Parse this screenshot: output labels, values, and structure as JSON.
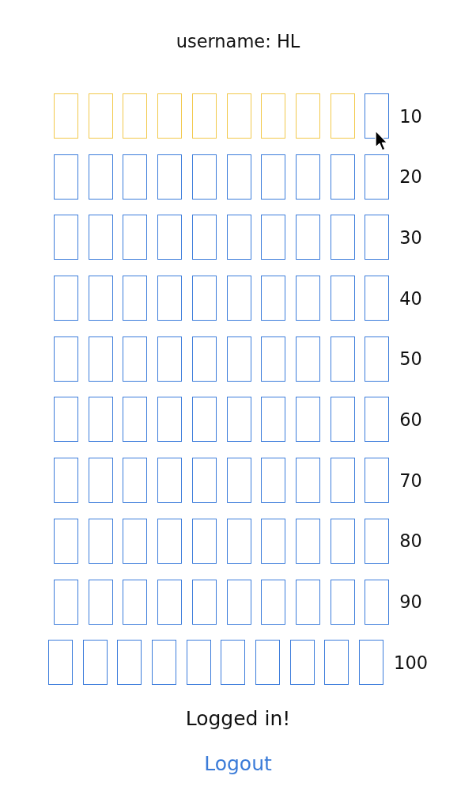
{
  "header": {
    "username_text": "username: HL"
  },
  "grid": {
    "rows": [
      {
        "label": "10",
        "cells": [
          {
            "selected": true,
            "hovered": false
          },
          {
            "selected": true,
            "hovered": false
          },
          {
            "selected": true,
            "hovered": false
          },
          {
            "selected": true,
            "hovered": false
          },
          {
            "selected": true,
            "hovered": false
          },
          {
            "selected": true,
            "hovered": false
          },
          {
            "selected": true,
            "hovered": false
          },
          {
            "selected": true,
            "hovered": false
          },
          {
            "selected": true,
            "hovered": false
          },
          {
            "selected": false,
            "hovered": true
          }
        ]
      },
      {
        "label": "20",
        "cells": [
          {
            "selected": false,
            "hovered": false
          },
          {
            "selected": false,
            "hovered": false
          },
          {
            "selected": false,
            "hovered": false
          },
          {
            "selected": false,
            "hovered": false
          },
          {
            "selected": false,
            "hovered": false
          },
          {
            "selected": false,
            "hovered": false
          },
          {
            "selected": false,
            "hovered": false
          },
          {
            "selected": false,
            "hovered": false
          },
          {
            "selected": false,
            "hovered": false
          },
          {
            "selected": false,
            "hovered": false
          }
        ]
      },
      {
        "label": "30",
        "cells": [
          {
            "selected": false,
            "hovered": false
          },
          {
            "selected": false,
            "hovered": false
          },
          {
            "selected": false,
            "hovered": false
          },
          {
            "selected": false,
            "hovered": false
          },
          {
            "selected": false,
            "hovered": false
          },
          {
            "selected": false,
            "hovered": false
          },
          {
            "selected": false,
            "hovered": false
          },
          {
            "selected": false,
            "hovered": false
          },
          {
            "selected": false,
            "hovered": false
          },
          {
            "selected": false,
            "hovered": false
          }
        ]
      },
      {
        "label": "40",
        "cells": [
          {
            "selected": false,
            "hovered": false
          },
          {
            "selected": false,
            "hovered": false
          },
          {
            "selected": false,
            "hovered": false
          },
          {
            "selected": false,
            "hovered": false
          },
          {
            "selected": false,
            "hovered": false
          },
          {
            "selected": false,
            "hovered": false
          },
          {
            "selected": false,
            "hovered": false
          },
          {
            "selected": false,
            "hovered": false
          },
          {
            "selected": false,
            "hovered": false
          },
          {
            "selected": false,
            "hovered": false
          }
        ]
      },
      {
        "label": "50",
        "cells": [
          {
            "selected": false,
            "hovered": false
          },
          {
            "selected": false,
            "hovered": false
          },
          {
            "selected": false,
            "hovered": false
          },
          {
            "selected": false,
            "hovered": false
          },
          {
            "selected": false,
            "hovered": false
          },
          {
            "selected": false,
            "hovered": false
          },
          {
            "selected": false,
            "hovered": false
          },
          {
            "selected": false,
            "hovered": false
          },
          {
            "selected": false,
            "hovered": false
          },
          {
            "selected": false,
            "hovered": false
          }
        ]
      },
      {
        "label": "60",
        "cells": [
          {
            "selected": false,
            "hovered": false
          },
          {
            "selected": false,
            "hovered": false
          },
          {
            "selected": false,
            "hovered": false
          },
          {
            "selected": false,
            "hovered": false
          },
          {
            "selected": false,
            "hovered": false
          },
          {
            "selected": false,
            "hovered": false
          },
          {
            "selected": false,
            "hovered": false
          },
          {
            "selected": false,
            "hovered": false
          },
          {
            "selected": false,
            "hovered": false
          },
          {
            "selected": false,
            "hovered": false
          }
        ]
      },
      {
        "label": "70",
        "cells": [
          {
            "selected": false,
            "hovered": false
          },
          {
            "selected": false,
            "hovered": false
          },
          {
            "selected": false,
            "hovered": false
          },
          {
            "selected": false,
            "hovered": false
          },
          {
            "selected": false,
            "hovered": false
          },
          {
            "selected": false,
            "hovered": false
          },
          {
            "selected": false,
            "hovered": false
          },
          {
            "selected": false,
            "hovered": false
          },
          {
            "selected": false,
            "hovered": false
          },
          {
            "selected": false,
            "hovered": false
          }
        ]
      },
      {
        "label": "80",
        "cells": [
          {
            "selected": false,
            "hovered": false
          },
          {
            "selected": false,
            "hovered": false
          },
          {
            "selected": false,
            "hovered": false
          },
          {
            "selected": false,
            "hovered": false
          },
          {
            "selected": false,
            "hovered": false
          },
          {
            "selected": false,
            "hovered": false
          },
          {
            "selected": false,
            "hovered": false
          },
          {
            "selected": false,
            "hovered": false
          },
          {
            "selected": false,
            "hovered": false
          },
          {
            "selected": false,
            "hovered": false
          }
        ]
      },
      {
        "label": "90",
        "cells": [
          {
            "selected": false,
            "hovered": false
          },
          {
            "selected": false,
            "hovered": false
          },
          {
            "selected": false,
            "hovered": false
          },
          {
            "selected": false,
            "hovered": false
          },
          {
            "selected": false,
            "hovered": false
          },
          {
            "selected": false,
            "hovered": false
          },
          {
            "selected": false,
            "hovered": false
          },
          {
            "selected": false,
            "hovered": false
          },
          {
            "selected": false,
            "hovered": false
          },
          {
            "selected": false,
            "hovered": false
          }
        ]
      },
      {
        "label": "100",
        "cells": [
          {
            "selected": false,
            "hovered": false
          },
          {
            "selected": false,
            "hovered": false
          },
          {
            "selected": false,
            "hovered": false
          },
          {
            "selected": false,
            "hovered": false
          },
          {
            "selected": false,
            "hovered": false
          },
          {
            "selected": false,
            "hovered": false
          },
          {
            "selected": false,
            "hovered": false
          },
          {
            "selected": false,
            "hovered": false
          },
          {
            "selected": false,
            "hovered": false
          },
          {
            "selected": false,
            "hovered": false
          }
        ]
      }
    ]
  },
  "status": {
    "text": "Logged in!"
  },
  "logout_link": {
    "label": "Logout"
  }
}
